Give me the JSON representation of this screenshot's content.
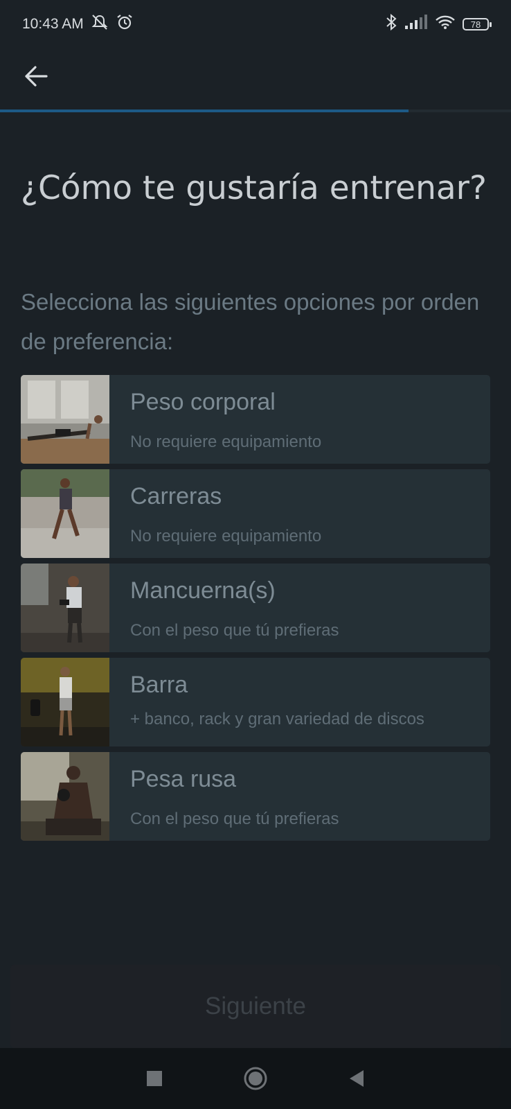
{
  "status_bar": {
    "time": "10:43 AM",
    "battery": "78",
    "icons": [
      "muted-alarm-icon",
      "alarm-icon",
      "bluetooth-icon",
      "signal-icon",
      "wifi-icon",
      "battery-icon"
    ]
  },
  "header": {
    "back_icon": "arrow-left-icon"
  },
  "progress": {
    "value_percent": 80
  },
  "title": "¿Cómo te gustaría entrenar?",
  "subtitle": "Selecciona las siguientes opciones por orden de preferencia:",
  "options": [
    {
      "title": "Peso corporal",
      "description": "No requiere equipamiento"
    },
    {
      "title": "Carreras",
      "description": "No requiere equipamiento"
    },
    {
      "title": "Mancuerna(s)",
      "description": "Con el peso que tú prefieras"
    },
    {
      "title": "Barra",
      "description": "+ banco, rack y gran variedad de discos"
    },
    {
      "title": "Pesa rusa",
      "description": "Con el peso que tú prefieras"
    }
  ],
  "next_button": {
    "label": "Siguiente"
  },
  "navbar": {
    "icons": [
      "recents-square-icon",
      "home-circle-icon",
      "back-triangle-icon"
    ]
  },
  "colors": {
    "background": "#1b2126",
    "card": "#253036",
    "progress": "#1d5a86"
  }
}
